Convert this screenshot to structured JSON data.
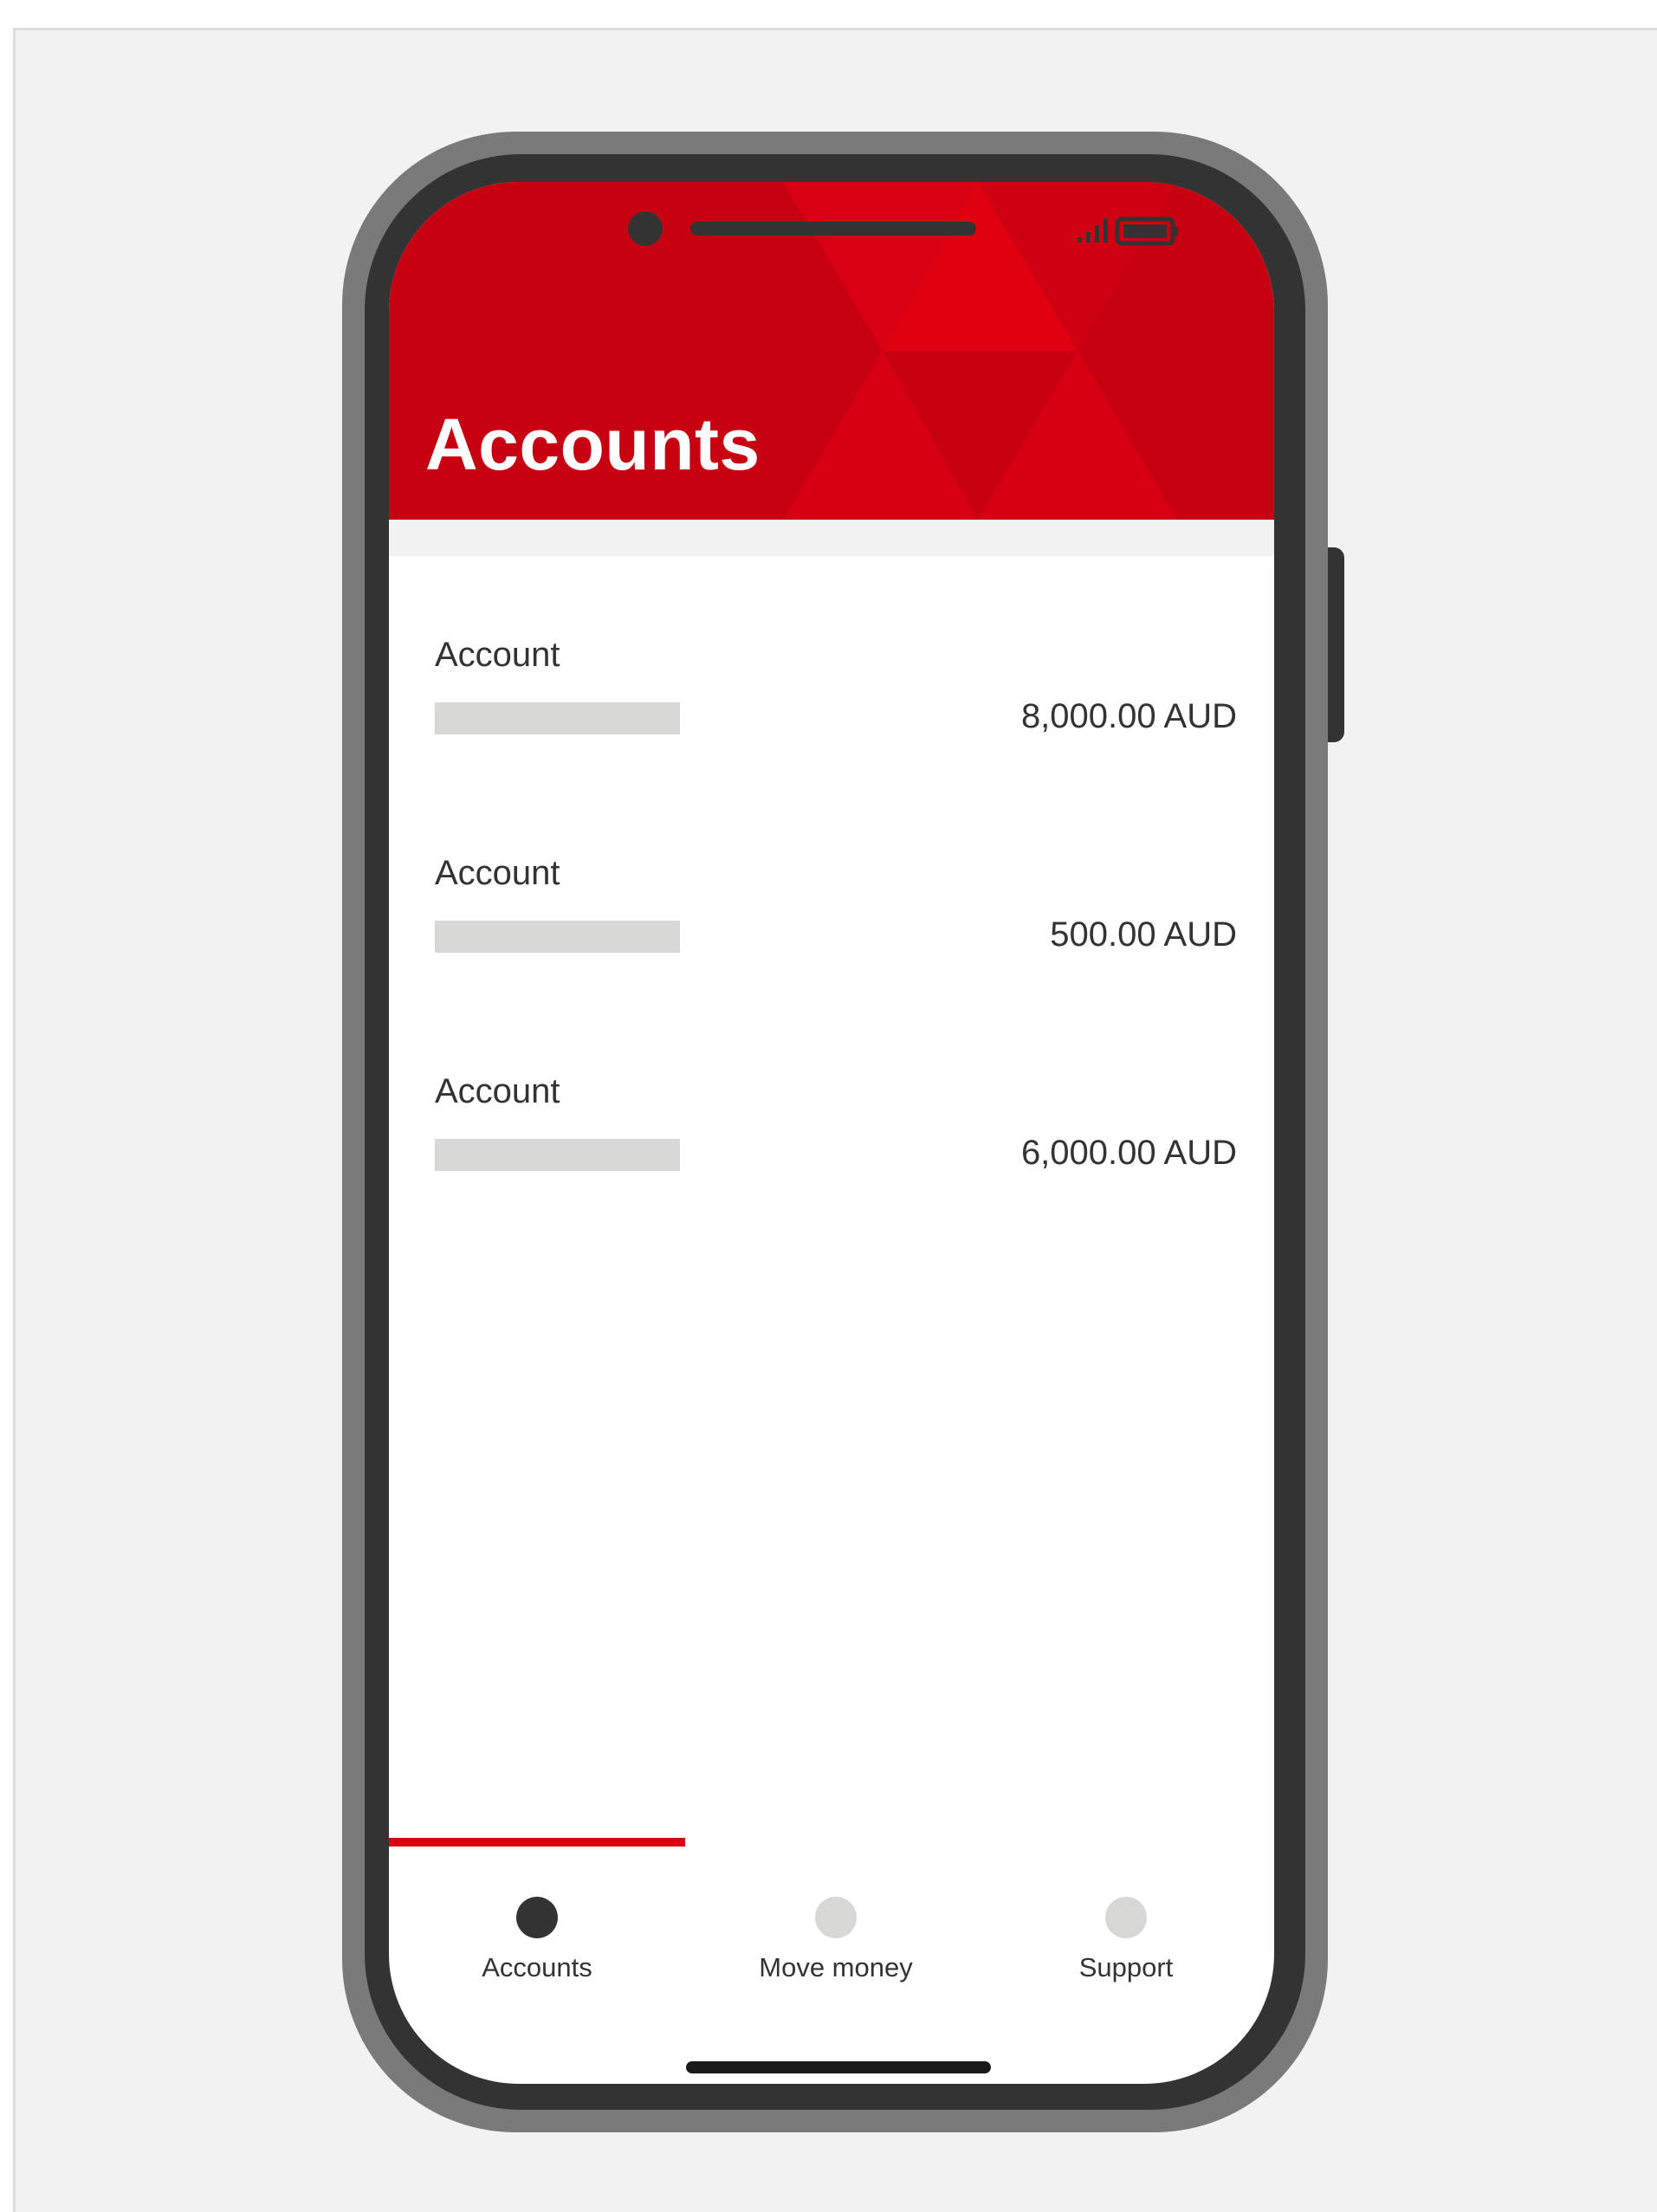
{
  "header": {
    "title": "Accounts",
    "brand_color": "#c70012",
    "status_icons": [
      "signal-icon",
      "battery-icon"
    ]
  },
  "accounts": [
    {
      "label": "Account",
      "amount": "8,000.00 AUD"
    },
    {
      "label": "Account",
      "amount": "500.00 AUD"
    },
    {
      "label": "Account",
      "amount": "6,000.00 AUD"
    }
  ],
  "bottom_nav": {
    "active": "Accounts",
    "accent_color": "#db0011",
    "items": [
      {
        "label": "Accounts",
        "icon": "dot-icon"
      },
      {
        "label": "Move money",
        "icon": "dot-icon"
      },
      {
        "label": "Support",
        "icon": "dot-icon"
      }
    ]
  }
}
